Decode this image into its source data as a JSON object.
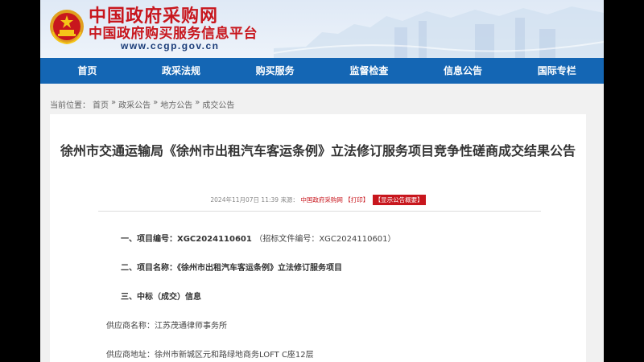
{
  "header": {
    "logo_main": "中国政府采购网",
    "logo_sub": "中国政府购买服务信息平台",
    "logo_url": "www.ccgp.gov.cn",
    "emblem_icon": "national-emblem-icon",
    "colors": {
      "logo_red": "#c8161d",
      "nav_blue": "#1466b4"
    }
  },
  "nav": {
    "items": [
      "首页",
      "政采法规",
      "购买服务",
      "监督检查",
      "信息公告",
      "国际专栏"
    ]
  },
  "breadcrumb": {
    "prefix": "当前位置：",
    "items": [
      "首页",
      "政采公告",
      "地方公告",
      "成交公告"
    ],
    "separator": "»"
  },
  "article": {
    "title": "徐州市交通运输局《徐州市出租汽车客运条例》立法修订服务项目竞争性磋商成交结果公告",
    "meta_date": "2024年11月07日 11:39",
    "meta_source_label": "来源：",
    "meta_source": "中国政府采购网",
    "meta_print": "【打印】",
    "meta_summary": "【显示公告概要】",
    "sections": {
      "s1_label": "一、项目编号：",
      "s1_value": "XGC2024110601",
      "s1_extra": "（招标文件编号：XGC2024110601）",
      "s2_label": "二、项目名称：",
      "s2_value": "《徐州市出租汽车客运条例》立法修订服务项目",
      "s3_label": "三、中标（成交）信息",
      "supplier_name_label": "供应商名称：",
      "supplier_name": "江苏茂通律师事务所",
      "supplier_addr_label": "供应商地址：",
      "supplier_addr": "徐州市新城区元和路绿地商务LOFT C座12层"
    }
  }
}
